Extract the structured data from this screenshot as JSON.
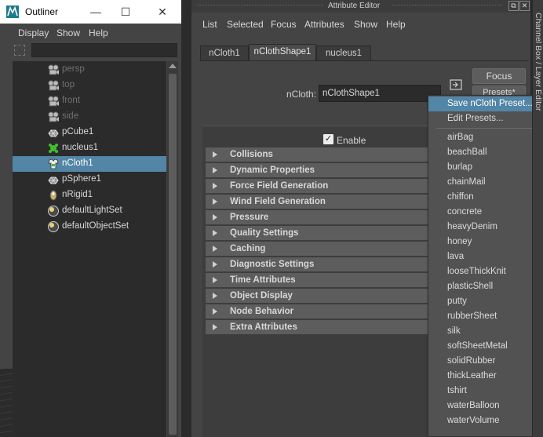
{
  "outliner": {
    "title": "Outliner",
    "menu": [
      "Display",
      "Show",
      "Help"
    ],
    "items": [
      {
        "label": "persp",
        "icon": "camera-icon",
        "dim": true
      },
      {
        "label": "top",
        "icon": "camera-icon",
        "dim": true
      },
      {
        "label": "front",
        "icon": "camera-icon",
        "dim": true
      },
      {
        "label": "side",
        "icon": "camera-icon",
        "dim": true
      },
      {
        "label": "pCube1",
        "icon": "mesh-icon",
        "dim": false
      },
      {
        "label": "nucleus1",
        "icon": "nucleus-icon",
        "dim": false
      },
      {
        "label": "nCloth1",
        "icon": "ncloth-icon",
        "dim": false,
        "selected": true
      },
      {
        "label": "pSphere1",
        "icon": "mesh-icon",
        "dim": false
      },
      {
        "label": "nRigid1",
        "icon": "nrigid-icon",
        "dim": false
      },
      {
        "label": "defaultLightSet",
        "icon": "set-icon",
        "dim": false
      },
      {
        "label": "defaultObjectSet",
        "icon": "set-icon",
        "dim": false
      }
    ]
  },
  "attribute_editor": {
    "title": "Attribute Editor",
    "menu": [
      "List",
      "Selected",
      "Focus",
      "Attributes",
      "Show",
      "Help"
    ],
    "tabs": [
      {
        "label": "nCloth1",
        "active": false
      },
      {
        "label": "nClothShape1",
        "active": true
      },
      {
        "label": "nucleus1",
        "active": false
      }
    ],
    "node_label": "nCloth:",
    "node_value": "nClothShape1",
    "focus_label": "Focus",
    "presets_label": "Presets*",
    "enable_label": "Enable",
    "enable_checked": true,
    "sections": [
      "Collisions",
      "Dynamic Properties",
      "Force Field Generation",
      "Wind Field Generation",
      "Pressure",
      "Quality Settings",
      "Caching",
      "Diagnostic Settings",
      "Time Attributes",
      "Object Display",
      "Node Behavior",
      "Extra Attributes"
    ]
  },
  "presets_menu": {
    "top_items": [
      {
        "label": "Save nCloth Preset...",
        "highlight": true
      },
      {
        "label": "Edit Presets...",
        "highlight": false
      }
    ],
    "presets": [
      "airBag",
      "beachBall",
      "burlap",
      "chainMail",
      "chiffon",
      "concrete",
      "heavyDenim",
      "honey",
      "lava",
      "looseThickKnit",
      "plasticShell",
      "putty",
      "rubberSheet",
      "silk",
      "softSheetMetal",
      "solidRubber",
      "thickLeather",
      "tshirt",
      "waterBalloon",
      "waterVolume"
    ]
  },
  "channel_box": {
    "label": "Channel Box / Layer Editor"
  },
  "colors": {
    "selection": "#5285a6",
    "panel": "#444444",
    "field": "#2b2b2b"
  }
}
